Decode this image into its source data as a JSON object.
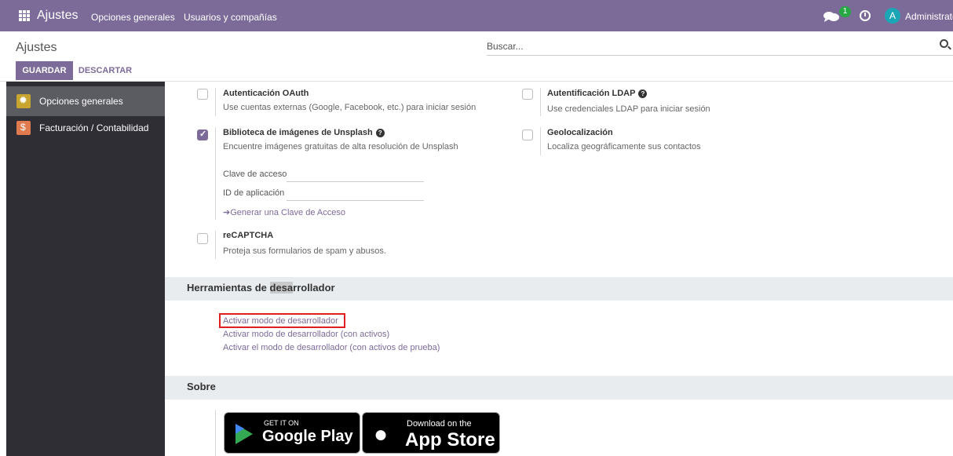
{
  "topbar": {
    "brand": "Ajustes",
    "menu": [
      "Opciones generales",
      "Usuarios y compañías"
    ],
    "chat_badge": "1",
    "avatar_letter": "A",
    "username": "Administrator"
  },
  "control": {
    "title": "Ajustes",
    "search_placeholder": "Buscar...",
    "save_label": "GUARDAR",
    "discard_label": "DESCARTAR"
  },
  "sidebar": {
    "items": [
      {
        "label": "Opciones generales",
        "icon": "gear-icon",
        "active": true
      },
      {
        "label": "Facturación / Contabilidad",
        "icon": "invoice-icon",
        "active": false
      }
    ]
  },
  "settings": {
    "oauth": {
      "title": "Autenticación OAuth",
      "desc": "Use cuentas externas (Google, Facebook, etc.) para iniciar sesión",
      "checked": false
    },
    "ldap": {
      "title": "Autentificación LDAP",
      "desc": "Use credenciales LDAP para iniciar sesión",
      "checked": false
    },
    "unsplash": {
      "title": "Biblioteca de imágenes de Unsplash",
      "desc": "Encuentre imágenes gratuitas de alta resolución de Unsplash",
      "checked": true,
      "access_key_label": "Clave de acceso",
      "app_id_label": "ID de aplicación",
      "generate_link": "Generar una Clave de Acceso"
    },
    "geo": {
      "title": "Geolocalización",
      "desc": "Localiza geográficamente sus contactos",
      "checked": false
    },
    "recaptcha": {
      "title": "reCAPTCHA",
      "desc": "Proteja sus formularios de spam y abusos.",
      "checked": false
    }
  },
  "dev_tools": {
    "heading_pre": "Herramientas de ",
    "heading_hl": "desa",
    "heading_post": "rrollador",
    "links": [
      "Activar modo de desarrollador",
      "Activar modo de desarrollador (con activos)",
      "Activar el modo de desarrollador (con activos de prueba)"
    ]
  },
  "about": {
    "heading": "Sobre",
    "google_small": "GET IT ON",
    "google_big": "Google Play",
    "apple_small": "Download on the",
    "apple_big": "App Store"
  },
  "colors": {
    "brand": "#7c6b99",
    "sidebar": "#2e2e34",
    "highlight": "#e02020"
  }
}
